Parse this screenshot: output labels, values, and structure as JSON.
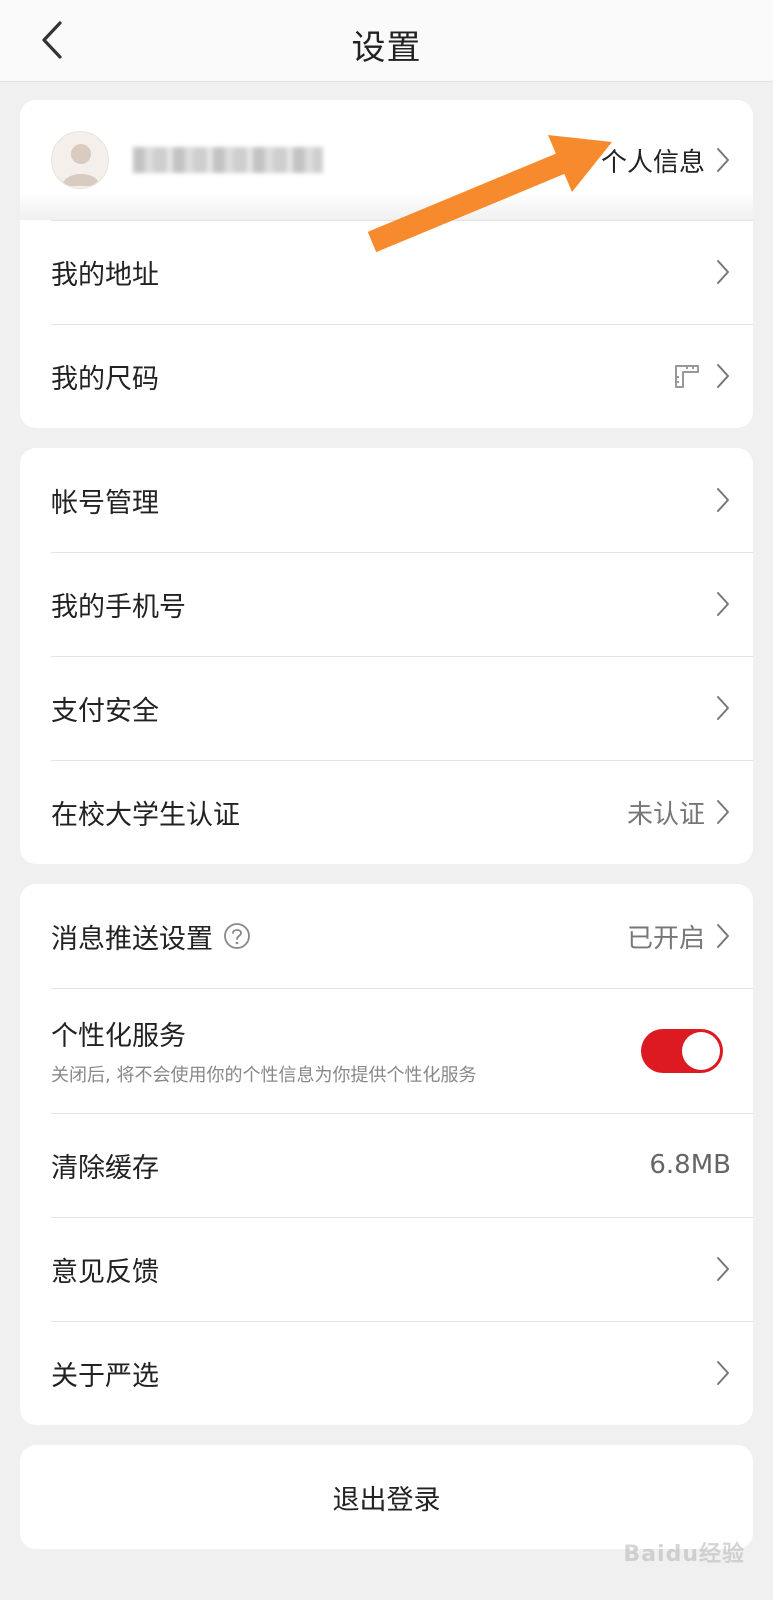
{
  "header": {
    "title": "设置",
    "back_icon": "chevron-left-icon"
  },
  "profile": {
    "name": "",
    "link_label": "个人信息"
  },
  "group1": [
    {
      "label": "我的地址"
    },
    {
      "label": "我的尺码",
      "icon": "ruler-icon"
    }
  ],
  "group2": [
    {
      "label": "帐号管理"
    },
    {
      "label": "我的手机号"
    },
    {
      "label": "支付安全"
    },
    {
      "label": "在校大学生认证",
      "value": "未认证"
    }
  ],
  "group3": {
    "push": {
      "label": "消息推送设置",
      "value": "已开启",
      "help_icon": "question-circle-icon"
    },
    "personalized": {
      "label": "个性化服务",
      "sub": "关闭后, 将不会使用你的个性信息为你提供个性化服务",
      "enabled": true
    },
    "cache": {
      "label": "清除缓存",
      "value": "6.8MB"
    },
    "feedback": {
      "label": "意见反馈"
    },
    "about": {
      "label": "关于严选"
    }
  },
  "logout": {
    "label": "退出登录"
  },
  "watermark": "Baidu经验",
  "colors": {
    "accent": "#dd1a21",
    "annotation_arrow": "#f78a2c",
    "background": "#f0f0f0"
  }
}
